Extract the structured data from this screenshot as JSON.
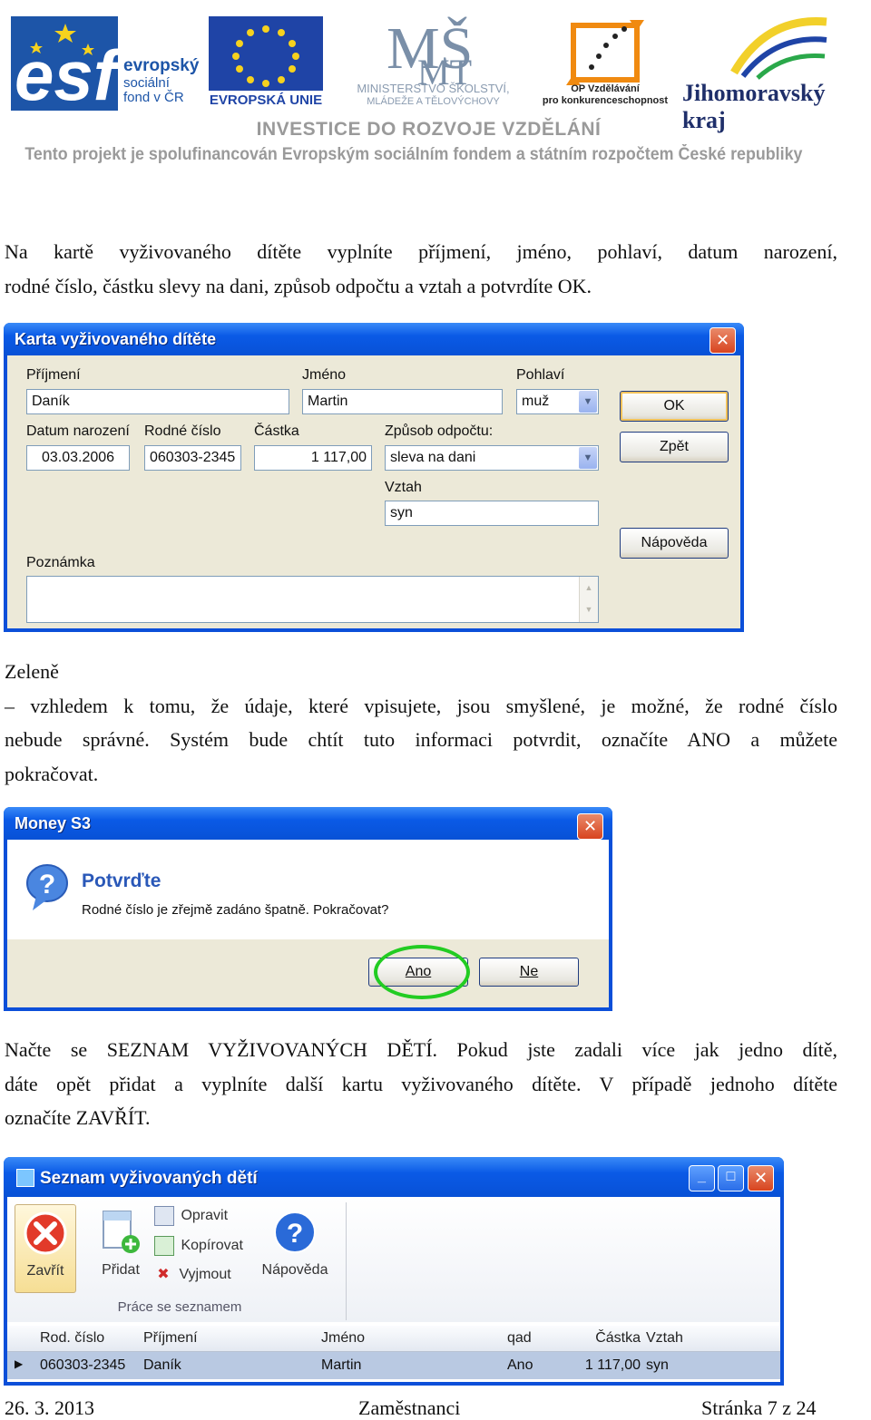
{
  "header": {
    "esf_text": [
      "evropský",
      "sociální",
      "fond v ČR"
    ],
    "eu_text": "EVROPSKÁ UNIE",
    "msmt_text": [
      "MINISTERSTVO ŠKOLSTVÍ,",
      "MLÁDEŽE A TĚLOVÝCHOVY"
    ],
    "op_text": [
      "OP Vzdělávání",
      "pro konkurenceschopnost"
    ],
    "kraj_text": "Jihomoravský kraj",
    "investice": "INVESTICE DO ROZVOJE VZDĚLÁNÍ",
    "projekt": "Tento projekt je spolufinancován Evropským sociálním fondem a státním rozpočtem České republiky"
  },
  "paragraph1": [
    "Na kartě vyživovaného dítěte vyplníte příjmení, jméno, pohlaví, datum narození,",
    "rodné číslo, částku slevy na dani, způsob odpočtu a vztah a potvrdíte OK."
  ],
  "dialog_karta": {
    "title": "Karta vyživovaného dítěte",
    "labels": {
      "prijmeni": "Příjmení",
      "jmeno": "Jméno",
      "pohlavi": "Pohlaví",
      "datum": "Datum narození",
      "rodne_cislo": "Rodné číslo",
      "castka": "Částka",
      "zpusob": "Způsob odpočtu:",
      "vztah": "Vztah",
      "poznamka": "Poznámka"
    },
    "values": {
      "prijmeni": "Daník",
      "jmeno": "Martin",
      "pohlavi": "muž",
      "datum": "03.03.2006",
      "rodne_cislo": "060303-2345",
      "castka": "1 117,00",
      "zpusob": "sleva na dani",
      "vztah": "syn",
      "poznamka": ""
    },
    "buttons": {
      "ok": "OK",
      "zpet": "Zpět",
      "napoveda": "Nápověda"
    }
  },
  "paragraph2": [
    "Zeleně",
    "– vzhledem k tomu, že údaje, které vpisujete, jsou smyšlené, je možné, že rodné číslo",
    "nebude správné. Systém bude chtít tuto informaci potvrdit, označíte ANO a můžete",
    "pokračovat."
  ],
  "dialog_money": {
    "title": "Money S3",
    "heading": "Potvrďte",
    "message": "Rodné číslo je zřejmě zadáno špatně. Pokračovat?",
    "buttons": {
      "ano": "Ano",
      "ne": "Ne"
    },
    "highlight_color": "#22cc22"
  },
  "paragraph3": [
    "Načte se SEZNAM VYŽIVOVANÝCH DĚTÍ. Pokud jste zadali více jak jedno dítě,",
    "dáte opět přidat a vyplníte další kartu vyživovaného dítěte. V případě jednoho dítěte",
    "označíte ZAVŘÍT."
  ],
  "seznam": {
    "title": "Seznam vyživovaných dětí",
    "toolbar": {
      "zavrit": "Zavřít",
      "pridat": "Přidat",
      "opravit": "Opravit",
      "kopirovat": "Kopírovat",
      "vyjmout": "Vyjmout",
      "napoveda": "Nápověda",
      "group": "Práce se seznamem"
    },
    "columns": [
      "Rod. číslo",
      "Příjmení",
      "Jméno",
      "qad",
      "Částka",
      "Vztah"
    ],
    "rows": [
      [
        "060303-2345",
        "Daník",
        "Martin",
        "Ano",
        "1 117,00",
        "syn"
      ]
    ]
  },
  "footer": {
    "date": "26. 3. 2013",
    "section": "Zaměstnanci",
    "page": "Stránka 7 z 24"
  }
}
